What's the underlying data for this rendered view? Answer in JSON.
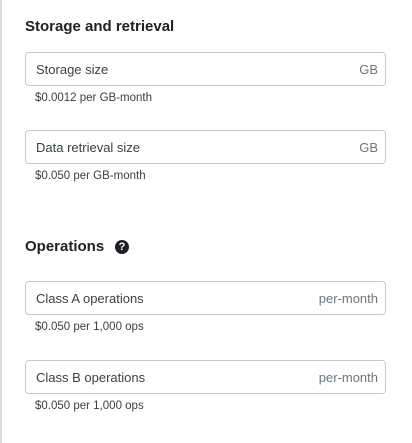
{
  "storage": {
    "title": "Storage and retrieval",
    "fields": [
      {
        "label": "Storage size",
        "suffix": "GB",
        "hint": "$0.0012 per GB-month"
      },
      {
        "label": "Data retrieval size",
        "suffix": "GB",
        "hint": "$0.050 per GB-month"
      }
    ]
  },
  "operations": {
    "title": "Operations",
    "help_icon": "help-circle-icon",
    "fields": [
      {
        "label": "Class A operations",
        "suffix": "per-month",
        "hint": "$0.050 per 1,000 ops"
      },
      {
        "label": "Class B operations",
        "suffix": "per-month",
        "hint": "$0.050 per 1,000 ops"
      }
    ]
  }
}
